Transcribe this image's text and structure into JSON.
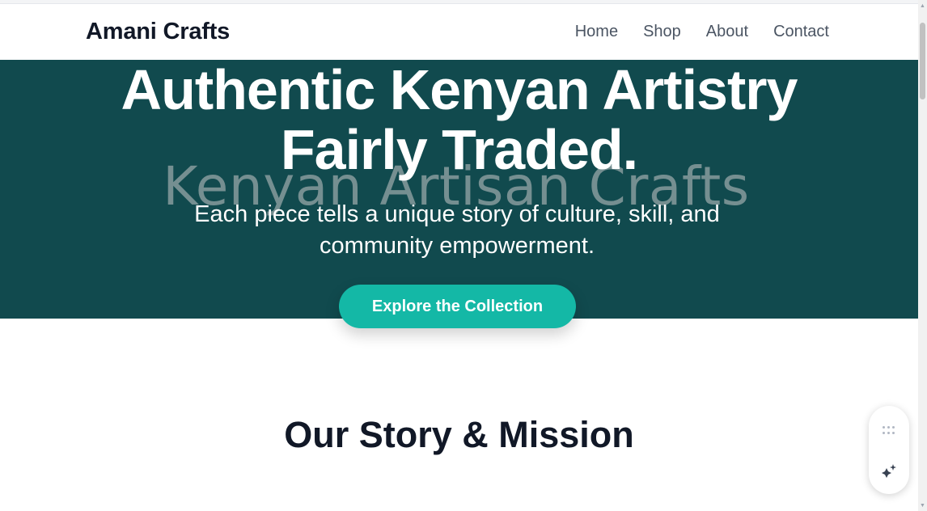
{
  "nav": {
    "brand": "Amani Crafts",
    "links": [
      "Home",
      "Shop",
      "About",
      "Contact"
    ]
  },
  "hero": {
    "title_line1": "Authentic Kenyan Artistry",
    "title_line2": "Fairly Traded.",
    "image_alt": "Kenyan Artisan Crafts",
    "subtitle": "Each piece tells a unique story of culture, skill, and community empowerment.",
    "cta_label": "Explore the Collection"
  },
  "story": {
    "title": "Our Story & Mission"
  },
  "floating_widget": {
    "icons": [
      "drag-handle-icon",
      "sparkle-icon"
    ]
  },
  "colors": {
    "hero_bg": "#114a4e",
    "accent": "#14b8a6",
    "heading": "#111827",
    "nav_link": "#4b5563"
  }
}
